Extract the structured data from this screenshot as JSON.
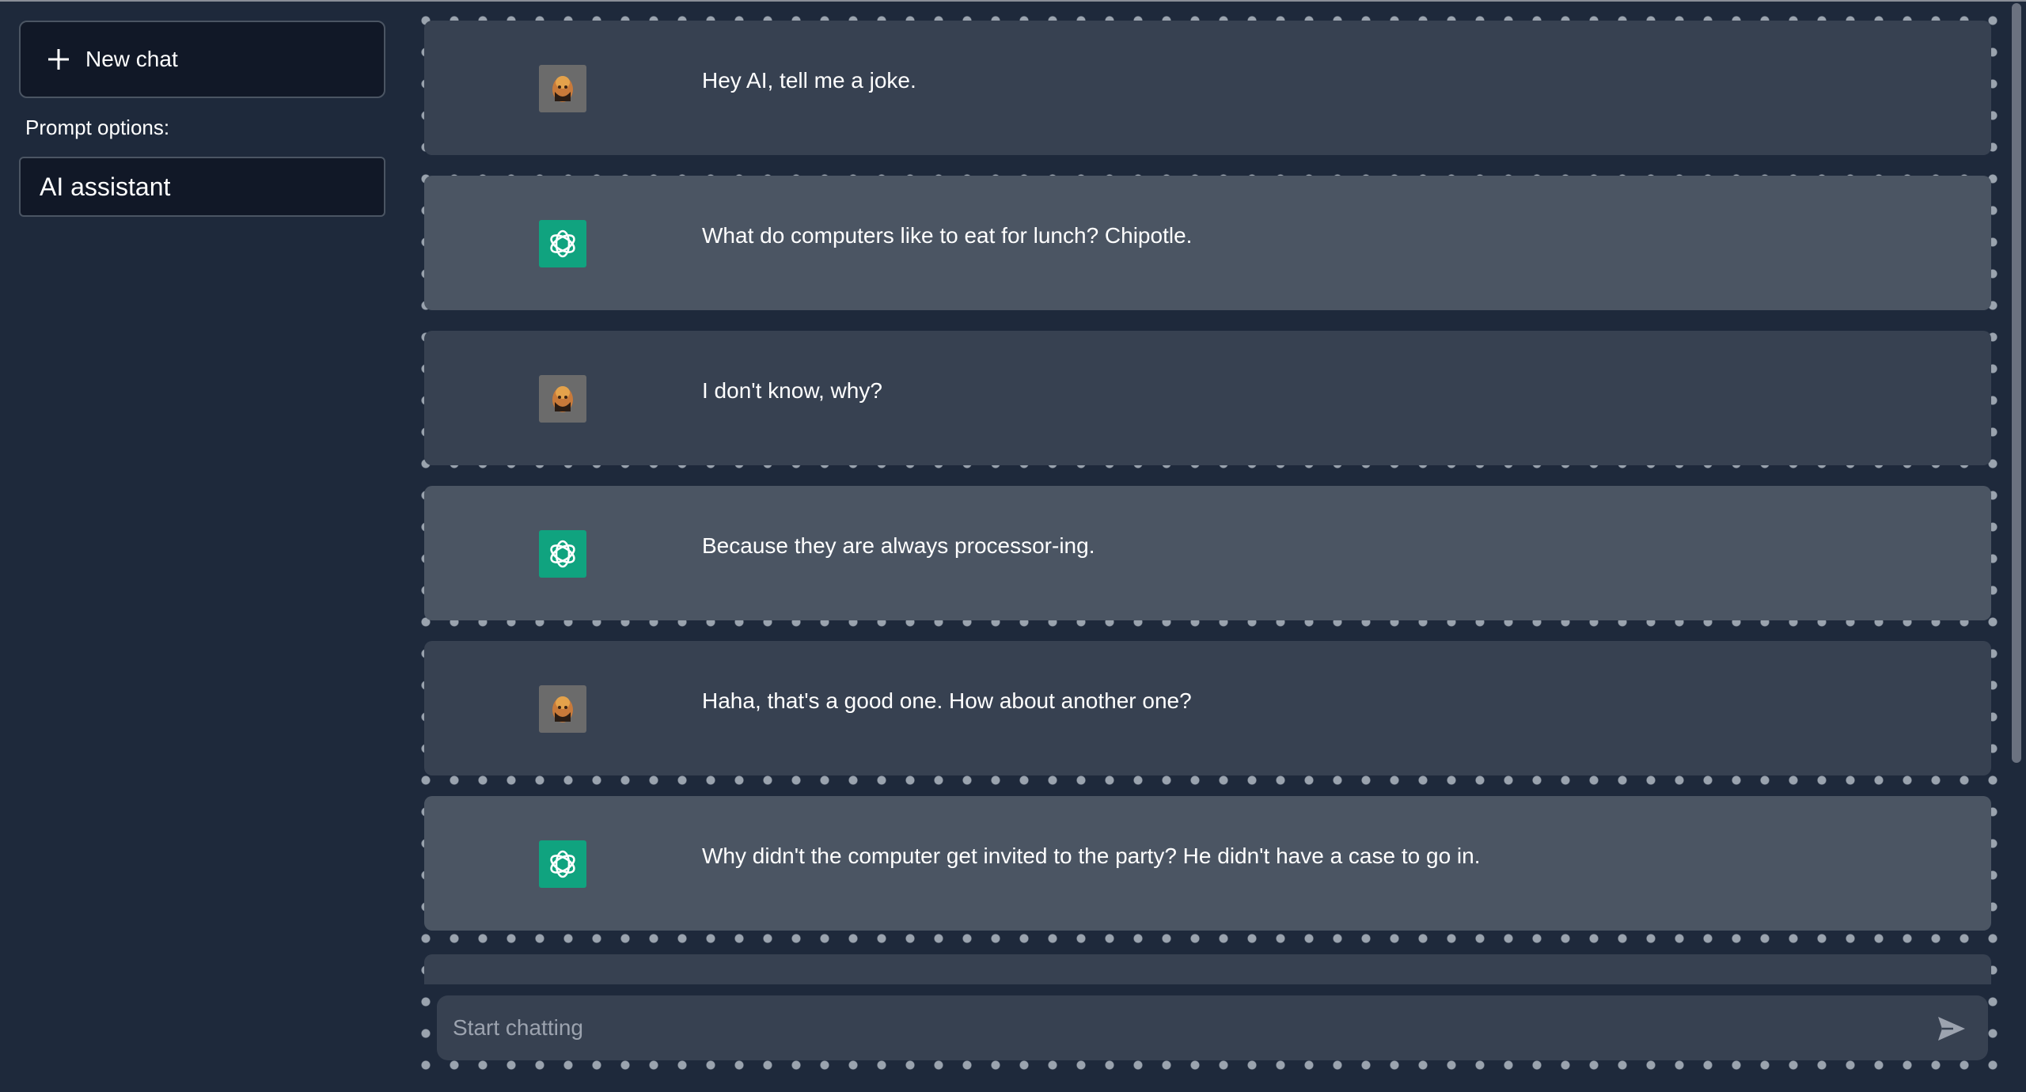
{
  "sidebar": {
    "new_chat_label": "New chat",
    "prompt_options_label": "Prompt options:",
    "prompt_selected": "AI assistant"
  },
  "messages": [
    {
      "role": "user",
      "text": "Hey AI, tell me a joke."
    },
    {
      "role": "ai",
      "text": "What do computers like to eat for lunch? Chipotle."
    },
    {
      "role": "user",
      "text": "I don't know, why?"
    },
    {
      "role": "ai",
      "text": "Because they are always processor-ing."
    },
    {
      "role": "user",
      "text": "Haha, that's a good one. How about another one?"
    },
    {
      "role": "ai",
      "text": "Why didn't the computer get invited to the party? He didn't have a case to go in."
    }
  ],
  "input": {
    "placeholder": "Start chatting"
  },
  "colors": {
    "background": "#1e293b",
    "user_message_bg": "#374151",
    "ai_message_bg": "#4b5563",
    "ai_avatar": "#10a37f"
  },
  "icons": {
    "new_chat": "plus-icon",
    "user_avatar": "user-avatar-icon",
    "ai_avatar": "openai-logo-icon",
    "send": "send-icon"
  }
}
